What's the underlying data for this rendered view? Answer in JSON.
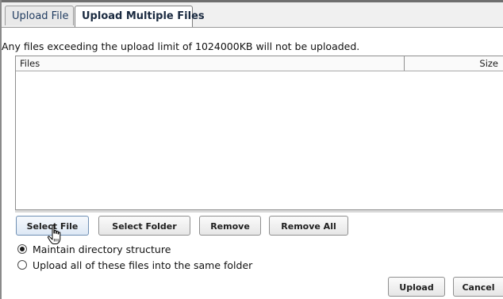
{
  "tabs": [
    {
      "label": "Upload File",
      "active": false
    },
    {
      "label": "Upload Multiple Files",
      "active": true
    }
  ],
  "limit_note": "Any files exceeding the upload limit of 1024000KB will not be uploaded.",
  "file_list": {
    "columns": {
      "files": "Files",
      "size": "Size"
    },
    "rows": []
  },
  "buttons": {
    "select_file": "Select File",
    "select_folder": "Select Folder",
    "remove": "Remove",
    "remove_all": "Remove All",
    "upload": "Upload",
    "cancel": "Cancel"
  },
  "options": {
    "maintain_structure": "Maintain directory structure",
    "same_folder": "Upload all of these files into the same folder",
    "selected": "maintain_structure"
  },
  "icons": {
    "cursor": "hand-pointer-icon"
  }
}
